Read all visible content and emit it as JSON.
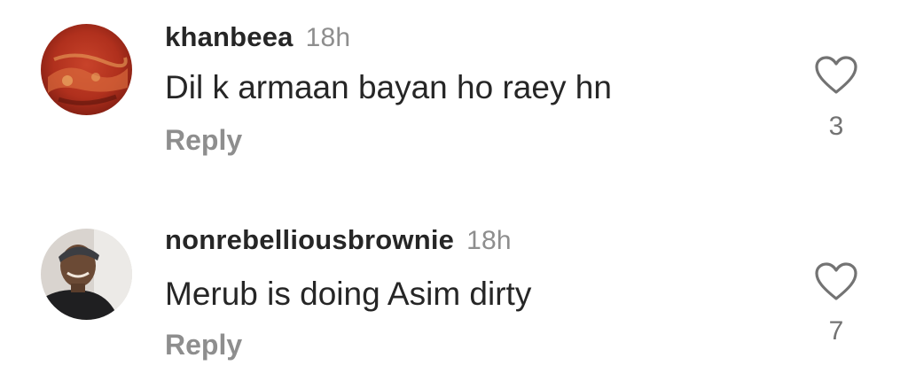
{
  "comments": [
    {
      "username": "khanbeea",
      "time": "18h",
      "text": "Dil k armaan bayan ho raey hn",
      "reply_label": "Reply",
      "likes": "3",
      "avatar_icon": "avatar-photo",
      "like_icon": "heart-outline-icon"
    },
    {
      "username": "nonrebelliousbrownie",
      "time": "18h",
      "text": "Merub is doing Asim dirty",
      "reply_label": "Reply",
      "likes": "7",
      "avatar_icon": "avatar-photo",
      "like_icon": "heart-outline-icon"
    }
  ],
  "colors": {
    "primary_text": "#262626",
    "secondary_text": "#8e8e8e",
    "background": "#ffffff"
  }
}
